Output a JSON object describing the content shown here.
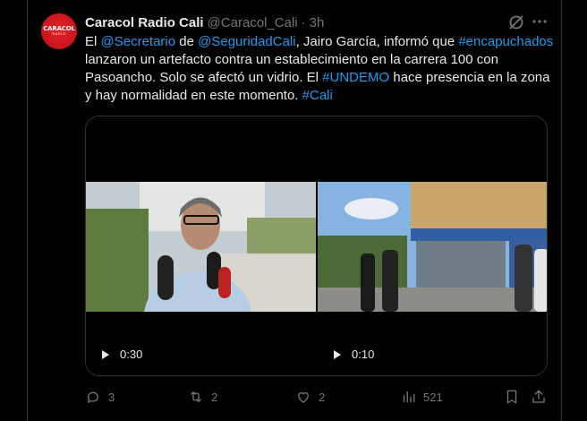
{
  "tweet": {
    "author_name": "Caracol Radio Cali",
    "handle": "@Caracol_Cali",
    "separator": "·",
    "time": "3h",
    "avatar_brand": "CARACOL",
    "avatar_sub": "RADIO",
    "text": {
      "t1": "El ",
      "m1": "@Secretario",
      "t2": " de ",
      "m2": "@SeguridadCali",
      "t3": ", Jairo García, informó que ",
      "h1": "#encapuchados",
      "t4": " lanzaron un artefacto contra un establecimiento en la carrera 100 con Pasoancho. Solo se afectó un vidrio. El ",
      "h2": "#UNDEMO",
      "t5": " hace presencia en la zona y hay normalidad en este momento. ",
      "h3": "#Cali"
    },
    "videos": [
      {
        "duration": "0:30"
      },
      {
        "duration": "0:10"
      }
    ],
    "actions": {
      "replies": "3",
      "reposts": "2",
      "likes": "2",
      "views": "521"
    }
  },
  "colors": {
    "link": "#1d9bf0",
    "muted": "#71767b",
    "text": "#e7e9ea",
    "background": "#000000",
    "brand_red": "#d7191f"
  },
  "icons": {
    "grok": "grok-icon",
    "more": "more-icon",
    "reply": "reply-icon",
    "repost": "repost-icon",
    "like": "heart-icon",
    "views": "views-icon",
    "bookmark": "bookmark-icon",
    "share": "share-icon",
    "play": "play-icon"
  }
}
